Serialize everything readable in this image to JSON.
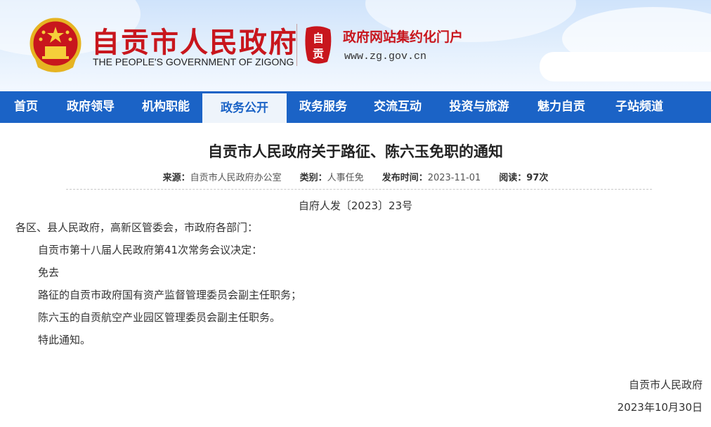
{
  "header": {
    "title": "自贡市人民政府",
    "subtitle": "THE PEOPLE'S GOVERNMENT OF ZIGONG",
    "seal_text": "自贡",
    "portal_label": "政府网站集约化门户",
    "portal_url": "www.zg.gov.cn",
    "search_placeholder": ""
  },
  "nav": {
    "items": [
      {
        "label": "首页"
      },
      {
        "label": "政府领导"
      },
      {
        "label": "机构职能"
      },
      {
        "label": "政务公开",
        "active": true
      },
      {
        "label": "政务服务"
      },
      {
        "label": "交流互动"
      },
      {
        "label": "投资与旅游"
      },
      {
        "label": "魅力自贡"
      },
      {
        "label": "子站频道"
      }
    ]
  },
  "article": {
    "title": "自贡市人民政府关于路征、陈六玉免职的通知",
    "meta": {
      "source_label": "来源：",
      "source": "自贡市人民政府办公室",
      "category_label": "类别：",
      "category": "人事任免",
      "date_label": "发布时间：",
      "date": "2023-11-01",
      "views_label": "阅读：",
      "views": "97次"
    },
    "doc_number": "自府人发〔2023〕23号",
    "salutation": "各区、县人民政府，高新区管委会，市政府各部门：",
    "paragraphs": [
      "自贡市第十八届人民政府第41次常务会议决定：",
      "免去",
      "路征的自贡市政府国有资产监督管理委员会副主任职务；",
      "陈六玉的自贡航空产业园区管理委员会副主任职务。",
      "特此通知。"
    ],
    "signature": "自贡市人民政府",
    "signature_date": "2023年10月30日"
  },
  "colors": {
    "brand_red": "#c8161d",
    "nav_blue": "#1b63c6",
    "active_tab_bg": "#eef4fb"
  }
}
